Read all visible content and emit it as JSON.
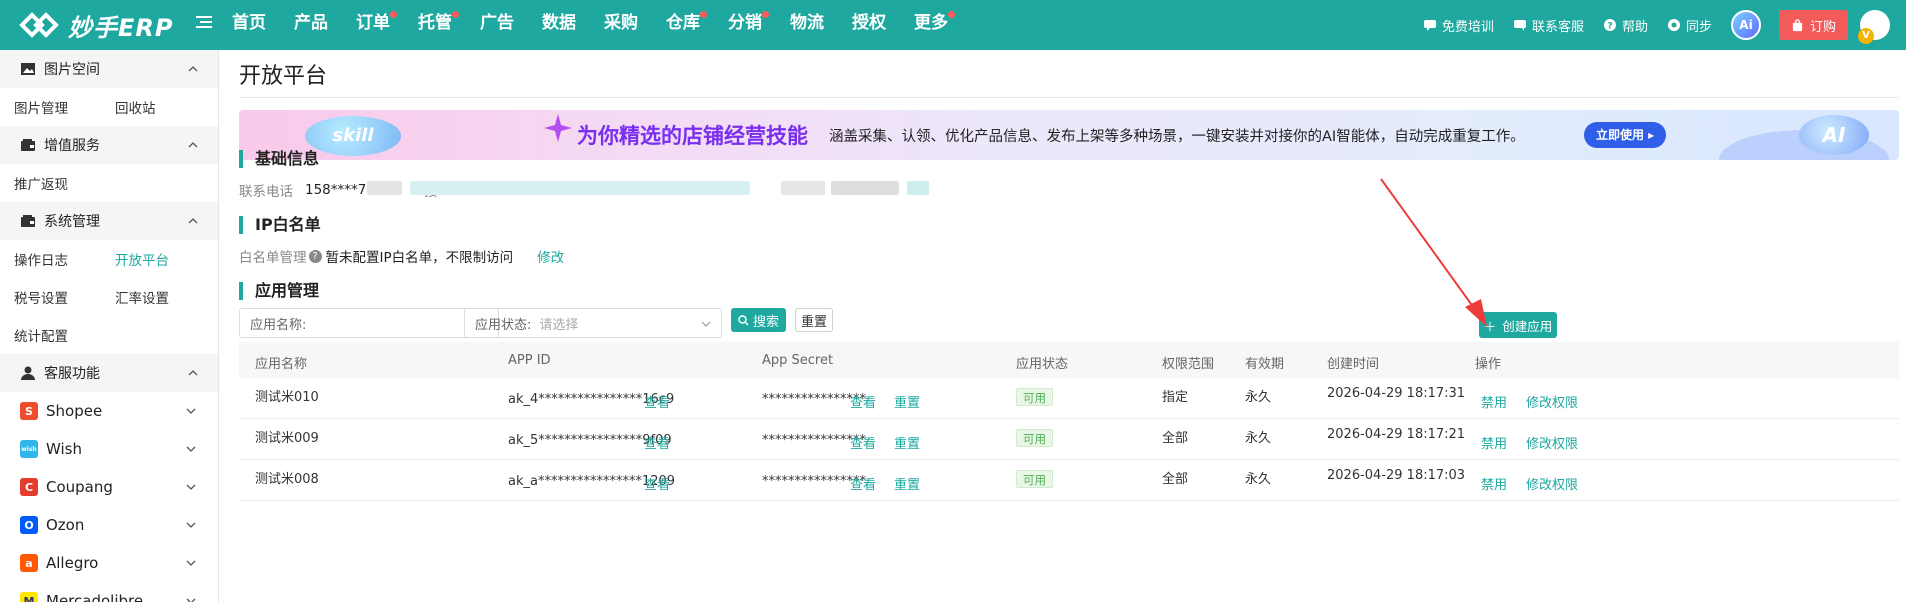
{
  "header": {
    "logo_text": "妙手ERP",
    "nav": [
      {
        "label": "首页",
        "dot": false
      },
      {
        "label": "产品",
        "dot": false
      },
      {
        "label": "订单",
        "dot": true
      },
      {
        "label": "托管",
        "dot": true
      },
      {
        "label": "广告",
        "dot": false
      },
      {
        "label": "数据",
        "dot": false
      },
      {
        "label": "采购",
        "dot": false
      },
      {
        "label": "仓库",
        "dot": true
      },
      {
        "label": "分销",
        "dot": true
      },
      {
        "label": "物流",
        "dot": false
      },
      {
        "label": "授权",
        "dot": false
      },
      {
        "label": "更多",
        "dot": true
      }
    ],
    "right": {
      "training": "免费培训",
      "service": "联系客服",
      "help": "帮助",
      "sync": "同步",
      "ai": "Ai",
      "order": "订购",
      "vip": "V"
    }
  },
  "sidebar": {
    "image_space": {
      "title": "图片空间",
      "items": [
        "图片管理",
        "回收站"
      ]
    },
    "value_service": {
      "title": "增值服务",
      "items": [
        "推广返现"
      ]
    },
    "system": {
      "title": "系统管理",
      "items": [
        "操作日志",
        "开放平台",
        "税号设置",
        "汇率设置",
        "统计配置"
      ],
      "active": "开放平台"
    },
    "customer": {
      "title": "客服功能"
    },
    "platforms": [
      {
        "name": "Shopee",
        "color": "#ee4d2d",
        "glyph": "S"
      },
      {
        "name": "Wish",
        "color": "#2fb7ec",
        "glyph": "wish"
      },
      {
        "name": "Coupang",
        "color": "#e43d30",
        "glyph": "C"
      },
      {
        "name": "Ozon",
        "color": "#005bff",
        "glyph": "O"
      },
      {
        "name": "Allegro",
        "color": "#ff5a00",
        "glyph": "a"
      },
      {
        "name": "Mercadolibre",
        "color": "#ffe600",
        "glyph": "M"
      }
    ]
  },
  "main": {
    "title": "开放平台",
    "banner": {
      "skill": "skill",
      "headline": "为你精选的店铺经营技能",
      "desc": "涵盖采集、认领、优化产品信息、发布上架等多种场景，一键安装并对接你的AI智能体，自动完成重复工作。",
      "button": "立即使用 ▸",
      "ai": "AI"
    },
    "basic": {
      "title": "基础信息",
      "phone_label": "联系电话",
      "phone": "158****7244",
      "partial": "接"
    },
    "whitelist": {
      "title": "IP白名单",
      "label": "白名单管理",
      "status": "暂未配置IP白名单，不限制访问",
      "edit": "修改"
    },
    "apps": {
      "title": "应用管理",
      "name_filter_label": "应用名称:",
      "status_filter_label": "应用状态:",
      "status_filter_placeholder": "请选择",
      "search": "搜索",
      "reset": "重置",
      "create": "创建应用",
      "columns": [
        "应用名称",
        "APP ID",
        "App Secret",
        "应用状态",
        "权限范围",
        "有效期",
        "创建时间",
        "操作"
      ],
      "rows": [
        {
          "name": "测试米010",
          "app_id": "ak_4****************16c9",
          "secret": "****************",
          "status": "可用",
          "scope": "指定",
          "validity": "永久",
          "created": "2026-04-29 18:17:31"
        },
        {
          "name": "测试米009",
          "app_id": "ak_5****************9f09",
          "secret": "****************",
          "status": "可用",
          "scope": "全部",
          "validity": "永久",
          "created": "2026-04-29 18:17:21"
        },
        {
          "name": "测试米008",
          "app_id": "ak_a****************1209",
          "secret": "****************",
          "status": "可用",
          "scope": "全部",
          "validity": "永久",
          "created": "2026-04-29 18:17:03"
        }
      ],
      "view": "查看",
      "reset_secret": "重置",
      "disable": "禁用",
      "edit_perm": "修改权限"
    }
  }
}
